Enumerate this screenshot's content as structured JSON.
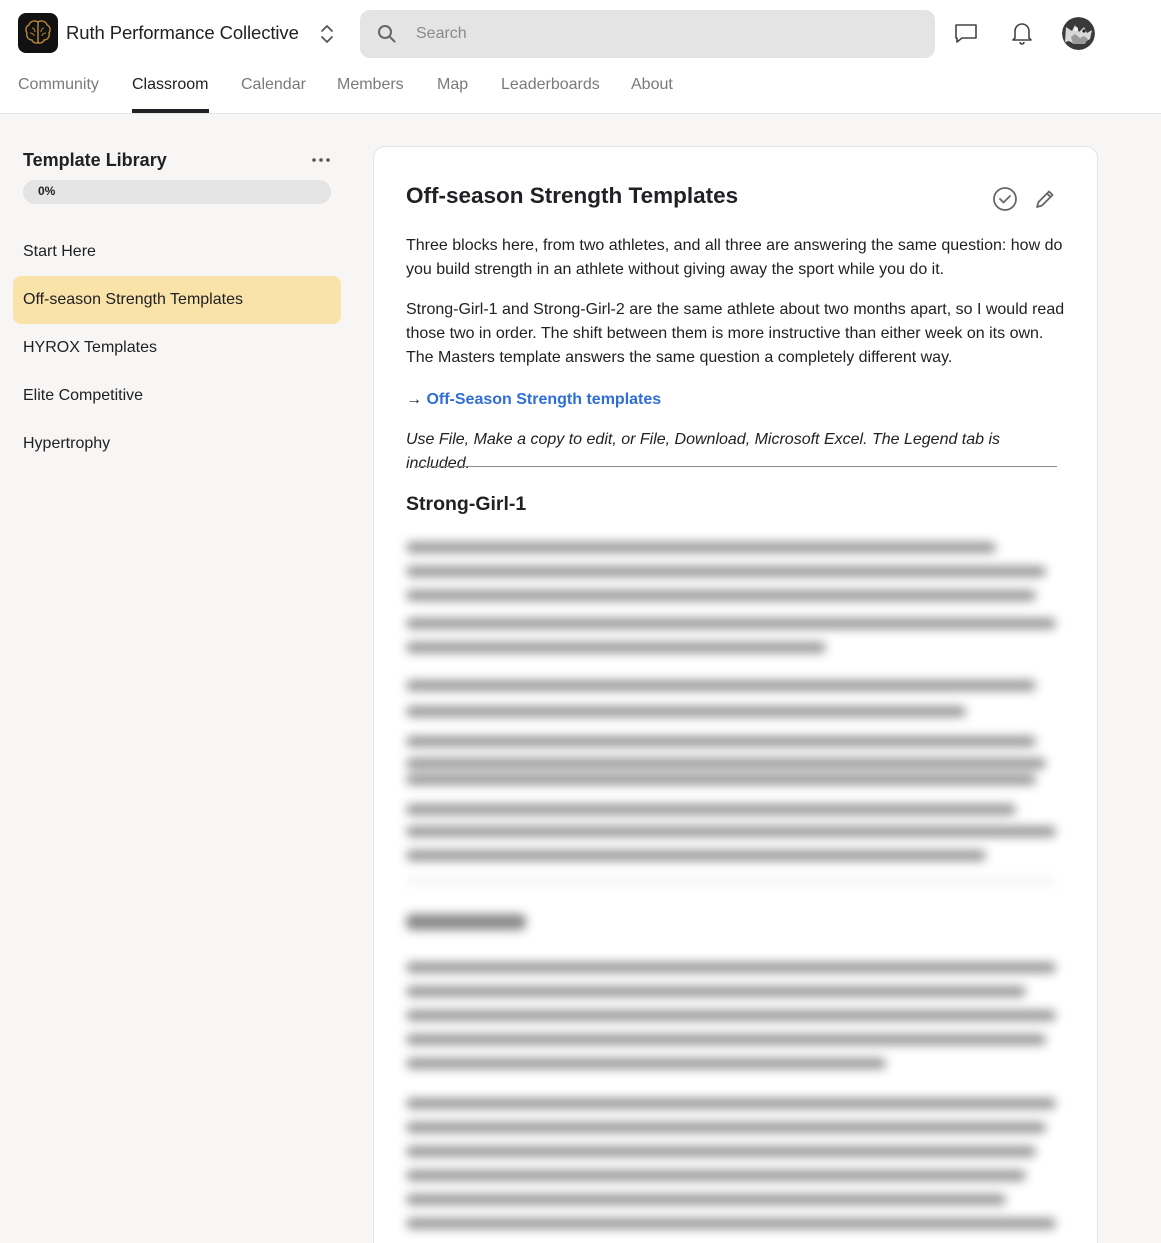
{
  "header": {
    "brand": "Ruth Performance Collective",
    "logo_icon": "brain-icon",
    "switcher_icon": "chevron-up-down-icon",
    "search": {
      "placeholder": "Search",
      "icon": "search-icon"
    },
    "icons": [
      "chat-icon",
      "bell-icon",
      "avatar"
    ]
  },
  "nav": {
    "tabs": [
      {
        "label": "Community"
      },
      {
        "label": "Classroom"
      },
      {
        "label": "Calendar"
      },
      {
        "label": "Members"
      },
      {
        "label": "Map"
      },
      {
        "label": "Leaderboards"
      },
      {
        "label": "About"
      }
    ],
    "active": "Classroom"
  },
  "sidebar": {
    "title": "Template Library",
    "more_icon": "more-horizontal-icon",
    "progress": {
      "label": "0%",
      "value": 0
    },
    "items": [
      {
        "label": "Start Here"
      },
      {
        "label": "Off-season Strength Templates",
        "active": true
      },
      {
        "label": "HYROX Templates"
      },
      {
        "label": "Elite Competitive"
      },
      {
        "label": "Hypertrophy"
      }
    ]
  },
  "content": {
    "title": "Off-season Strength Templates",
    "actions": [
      "check-circle-icon",
      "edit-pencil-icon"
    ],
    "paragraphs": [
      "Three blocks here, from two athletes, and all three are answering the same question: how do you build strength in an athlete without giving away the sport while you do it.",
      "Strong-Girl-1 and Strong-Girl-2 are the same athlete about two months apart, so I would read those two in order. The shift between them is more instructive than either week on its own. The Masters template answers the same question a completely different way."
    ],
    "link_arrow": "→",
    "link_text": "Off-Season Strength templates",
    "note": "Use File, Make a copy to edit, or File, Download, Microsoft Excel. The Legend tab is included.",
    "section_heading": "Strong-Girl-1"
  },
  "colors": {
    "active_item_bg": "#fae3a9",
    "link": "#2e6ed6",
    "page_bg": "#f7f6f4"
  }
}
